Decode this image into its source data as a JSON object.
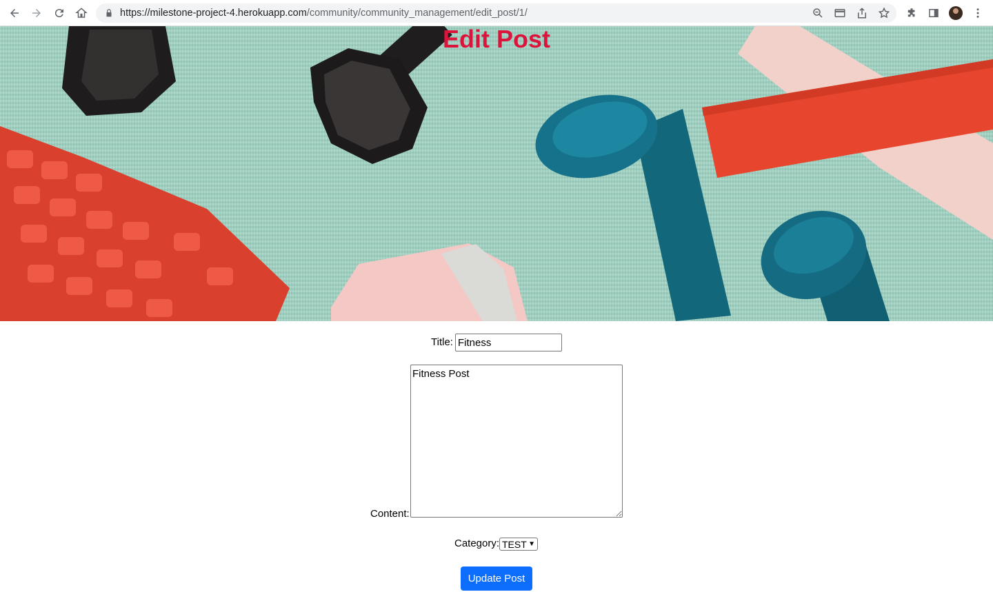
{
  "browser": {
    "url_host": "https://milestone-project-4.herokuapp.com",
    "url_path": "/community/community_management/edit_post/1/",
    "icons": [
      "back-icon",
      "forward-icon",
      "reload-icon",
      "home-icon",
      "lock-icon",
      "zoom-icon",
      "card-icon",
      "share-icon",
      "star-icon",
      "extensions-icon",
      "sidepanel-icon",
      "profile-avatar",
      "menu-icon"
    ]
  },
  "page": {
    "title": "Edit Post",
    "title_color": "#dc143c"
  },
  "form": {
    "title_label": "Title:",
    "title_value": "Fitness",
    "content_label": "Content:",
    "content_value": "Fitness Post",
    "category_label": "Category:",
    "category_value": "TEST",
    "submit_label": "Update Post",
    "submit_color": "#0d6efd"
  }
}
